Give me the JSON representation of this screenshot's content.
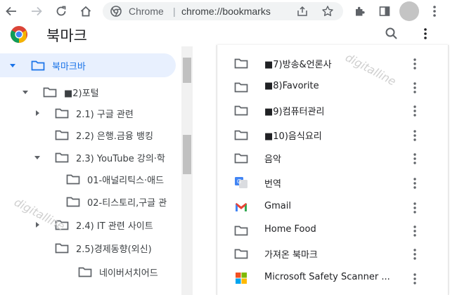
{
  "omnibox": {
    "site_label": "Chrome",
    "separator": "|",
    "url": "chrome://bookmarks"
  },
  "header": {
    "title": "북마크"
  },
  "tree": {
    "items": [
      {
        "label": "북마크바",
        "expanded": true,
        "selected": true
      },
      {
        "label": "■2)포털",
        "expanded": true
      },
      {
        "label": "2.1) 구글 관련",
        "expanded": false
      },
      {
        "label": "2.2) 은행.금융 뱅킹"
      },
      {
        "label": "2.3) YouTube 강의·학",
        "expanded": true
      },
      {
        "label": "01-애널리틱스·애드"
      },
      {
        "label": "02-티스토리,구글 관"
      },
      {
        "label": "2.4) IT 관련 사이트",
        "expanded": false
      },
      {
        "label": "2.5)경제동향(외신)"
      },
      {
        "label": "네이버서치어드"
      }
    ]
  },
  "list": {
    "items": [
      {
        "label": "■7)방송&언론사",
        "icon": "folder-icon"
      },
      {
        "label": "■8)Favorite",
        "icon": "folder-icon"
      },
      {
        "label": "■9)컴퓨터관리",
        "icon": "folder-icon"
      },
      {
        "label": "■10)음식요리",
        "icon": "folder-icon"
      },
      {
        "label": "음악",
        "icon": "folder-icon"
      },
      {
        "label": "번역",
        "icon": "google-translate-icon"
      },
      {
        "label": "Gmail",
        "icon": "gmail-icon"
      },
      {
        "label": "Home Food",
        "icon": "folder-icon"
      },
      {
        "label": "가져온 북마크",
        "icon": "folder-icon"
      },
      {
        "label": "Microsoft Safety Scanner ...",
        "icon": "microsoft-icon"
      }
    ]
  },
  "watermarks": [
    "digitalline",
    "digitalline"
  ],
  "colors": {
    "accent": "#1a73e8",
    "selected_bg": "#e8f0fe",
    "icon_gray": "#5f6368"
  }
}
